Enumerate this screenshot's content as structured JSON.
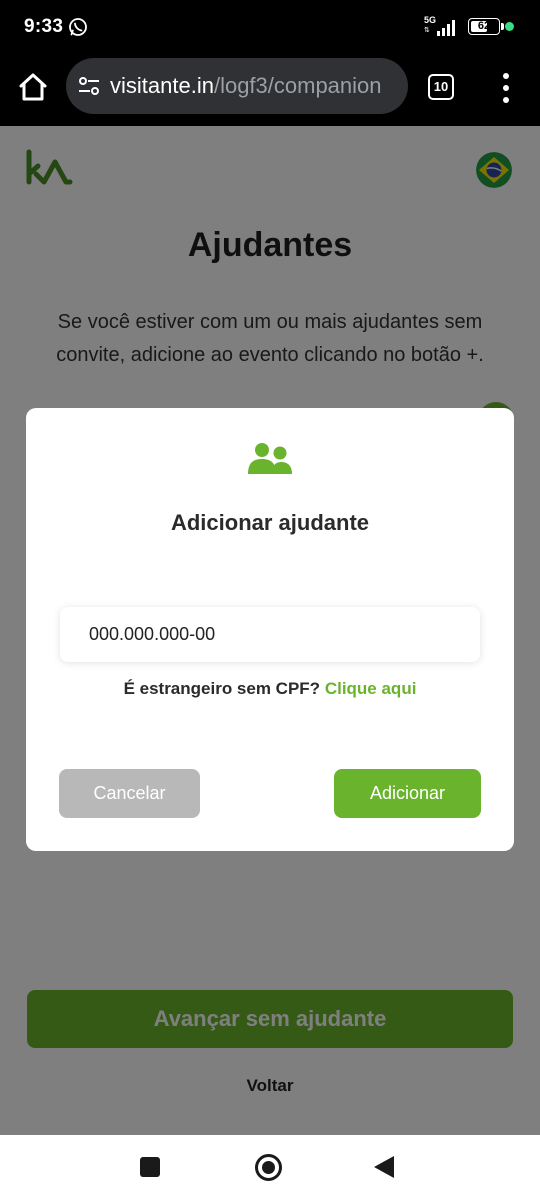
{
  "status_bar": {
    "time": "9:33",
    "network": "5G",
    "battery_level": "62",
    "battery_fraction": 0.62,
    "whatsapp_icon": "whatsapp-icon",
    "accent_dot_color": "#3ddc84"
  },
  "browser": {
    "url_domain": "visitante.in",
    "url_path": "/logf3/companion",
    "tab_count": "10"
  },
  "page": {
    "title": "Ajudantes",
    "description": "Se você estiver com um ou mais ajudantes sem convite, adicione ao evento clicando no botão +.",
    "primary_button": "Avançar sem ajudante",
    "back_link": "Voltar",
    "language_flag": "brazil-flag-icon",
    "brand_color": "#6ab42d"
  },
  "modal": {
    "icon": "users-icon",
    "title": "Adicionar ajudante",
    "cpf_value": "000.000.000-00",
    "foreign_question": "É estrangeiro sem CPF?",
    "foreign_link": "Clique aqui",
    "cancel_label": "Cancelar",
    "add_label": "Adicionar"
  }
}
